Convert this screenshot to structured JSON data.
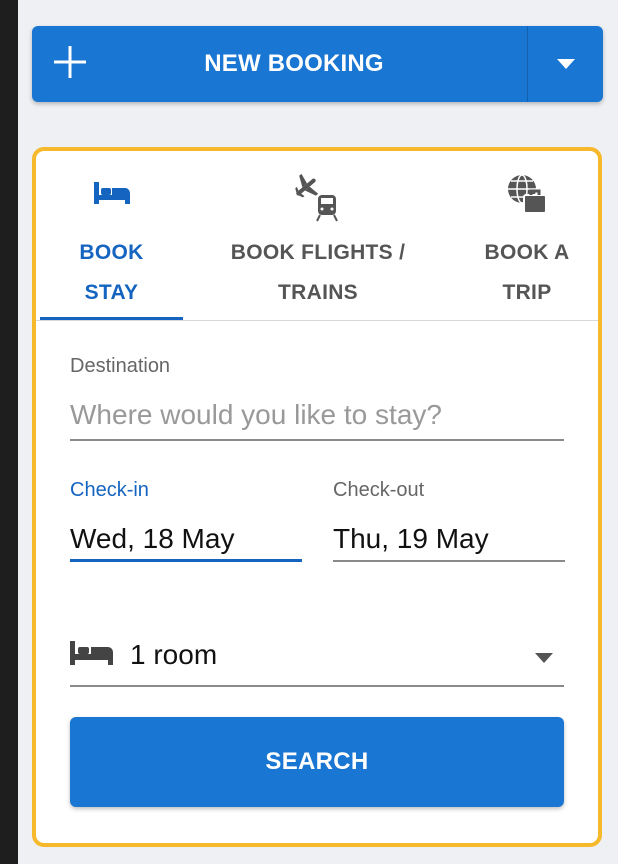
{
  "header": {
    "new_booking_label": "NEW BOOKING",
    "icons": {
      "add": "plus-icon",
      "dropdown": "caret-down-icon"
    }
  },
  "tabs": [
    {
      "label_line1": "BOOK",
      "label_line2": "STAY",
      "icon": "bed-icon",
      "active": true
    },
    {
      "label_line1": "BOOK FLIGHTS /",
      "label_line2": "TRAINS",
      "icon": "plane-train-icon",
      "active": false
    },
    {
      "label_line1": "BOOK A",
      "label_line2": "TRIP",
      "icon": "globe-briefcase-icon",
      "active": false
    }
  ],
  "form": {
    "destination": {
      "label": "Destination",
      "placeholder": "Where would you like to stay?",
      "value": ""
    },
    "check_in": {
      "label": "Check-in",
      "value": "Wed, 18 May"
    },
    "check_out": {
      "label": "Check-out",
      "value": "Thu, 19 May"
    },
    "rooms": {
      "value": "1 room",
      "icon": "bed-icon"
    },
    "search_label": "SEARCH"
  },
  "colors": {
    "primary": "#1976d2",
    "active_tab": "#1565c0",
    "card_border": "#f6b92b",
    "panel_background": "#eef0f3",
    "page_background": "#1e1e1e"
  }
}
